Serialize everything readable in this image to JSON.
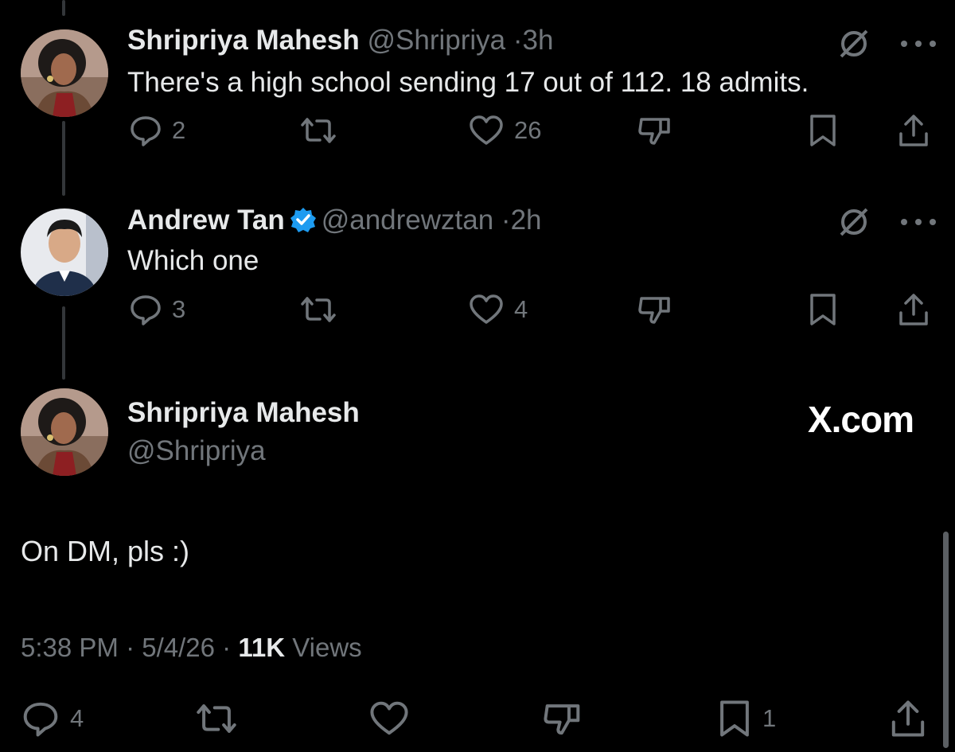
{
  "tweets": [
    {
      "name": "Shripriya Mahesh",
      "handle": "@Shripriya",
      "separator": "·",
      "time": "3h",
      "text": "There's a high school sending 17 out of 112. 18 admits.",
      "replies": "2",
      "retweets": "",
      "likes": "26",
      "bookmarks": ""
    },
    {
      "name": "Andrew Tan",
      "handle": "@andrewztan",
      "separator": "·",
      "time": "2h",
      "verified": true,
      "text": "Which one",
      "replies": "3",
      "retweets": "",
      "likes": "4",
      "bookmarks": ""
    }
  ],
  "main_tweet": {
    "name": "Shripriya Mahesh",
    "handle": "@Shripriya",
    "text": "On DM, pls :)",
    "timestamp": "5:38 PM",
    "date": "5/4/26",
    "separator": "·",
    "views_count": "11K",
    "views_label": "Views",
    "replies": "4",
    "retweets": "",
    "likes": "",
    "bookmarks": "1"
  },
  "watermark": "X.com",
  "colors": {
    "background": "#000000",
    "text_primary": "#e7e9ea",
    "text_secondary": "#71767b",
    "verified_blue": "#1d9bf0",
    "thread_line": "#333639"
  },
  "icons": [
    "reply-icon",
    "retweet-icon",
    "like-icon",
    "dislike-icon",
    "bookmark-icon",
    "share-icon",
    "grok-icon",
    "more-icon",
    "verified-icon"
  ]
}
